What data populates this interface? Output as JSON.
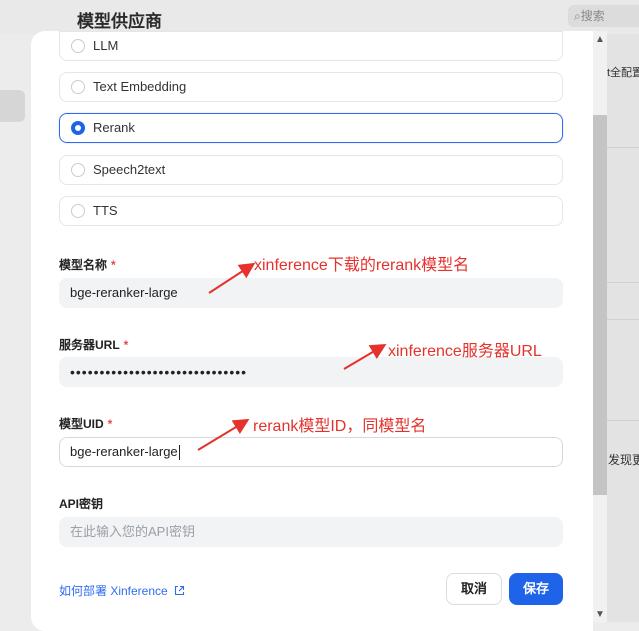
{
  "background": {
    "title": "模型供应商",
    "search_placeholder": "搜索",
    "right_text_1": "t全配置",
    "right_text_2": "发现更"
  },
  "model_types": [
    {
      "label": "LLM",
      "selected": false
    },
    {
      "label": "Text Embedding",
      "selected": false
    },
    {
      "label": "Rerank",
      "selected": true
    },
    {
      "label": "Speech2text",
      "selected": false
    },
    {
      "label": "TTS",
      "selected": false
    }
  ],
  "form": {
    "model_name_label": "模型名称",
    "model_name_value": "bge-reranker-large",
    "server_url_label": "服务器URL",
    "server_url_value": "••••••••••••••••••••••••••••••",
    "model_uid_label": "模型UID",
    "model_uid_value": "bge-reranker-large",
    "api_key_label": "API密钥",
    "api_key_placeholder": "在此输入您的API密钥",
    "required_mark": "*"
  },
  "footer": {
    "deploy_link": "如何部署 Xinference",
    "cancel": "取消",
    "save": "保存"
  },
  "annotations": {
    "model_name_note": "xinference下载的rerank模型名",
    "server_url_note": "xinference服务器URL",
    "model_uid_note": "rerank模型ID，同模型名"
  },
  "colors": {
    "accent": "#1f63e8",
    "annotation": "#e5322d",
    "required": "#e14a4a"
  }
}
